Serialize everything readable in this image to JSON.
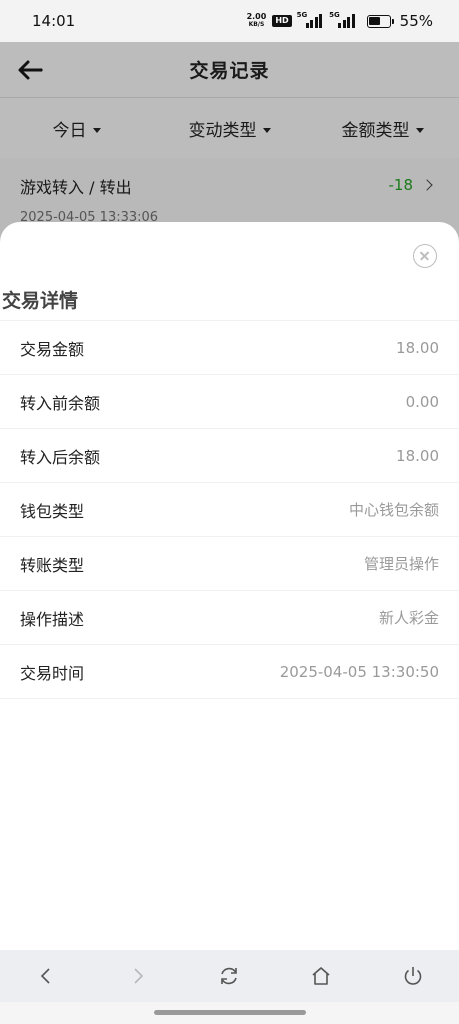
{
  "status_bar": {
    "time": "14:01",
    "net_speed_value": "2.00",
    "net_speed_unit": "KB/S",
    "hd_label": "HD",
    "signal1_tag": "5G",
    "signal2_tag": "5G",
    "battery_percent": "55%",
    "battery_level": 0.55
  },
  "header": {
    "title": "交易记录",
    "back_icon": "back-arrow-icon"
  },
  "filters": [
    {
      "label": "今日"
    },
    {
      "label": "变动类型"
    },
    {
      "label": "金额类型"
    }
  ],
  "record": {
    "title": "游戏转入 / 转出",
    "time": "2025-04-05 13:33:06",
    "amount": "-18",
    "amount_color": "#1c7a1c"
  },
  "sheet": {
    "title": "交易详情",
    "close_icon": "close-circle-icon",
    "rows": [
      {
        "label": "交易金额",
        "value": "18.00"
      },
      {
        "label": "转入前余额",
        "value": "0.00"
      },
      {
        "label": "转入后余额",
        "value": "18.00"
      },
      {
        "label": "钱包类型",
        "value": "中心钱包余额"
      },
      {
        "label": "转账类型",
        "value": "管理员操作"
      },
      {
        "label": "操作描述",
        "value": "新人彩金"
      },
      {
        "label": "交易时间",
        "value": "2025-04-05 13:30:50"
      }
    ]
  },
  "bottom_nav": {
    "icons": [
      "back-chevron-icon",
      "forward-chevron-icon",
      "refresh-icon",
      "home-icon",
      "power-icon"
    ]
  }
}
